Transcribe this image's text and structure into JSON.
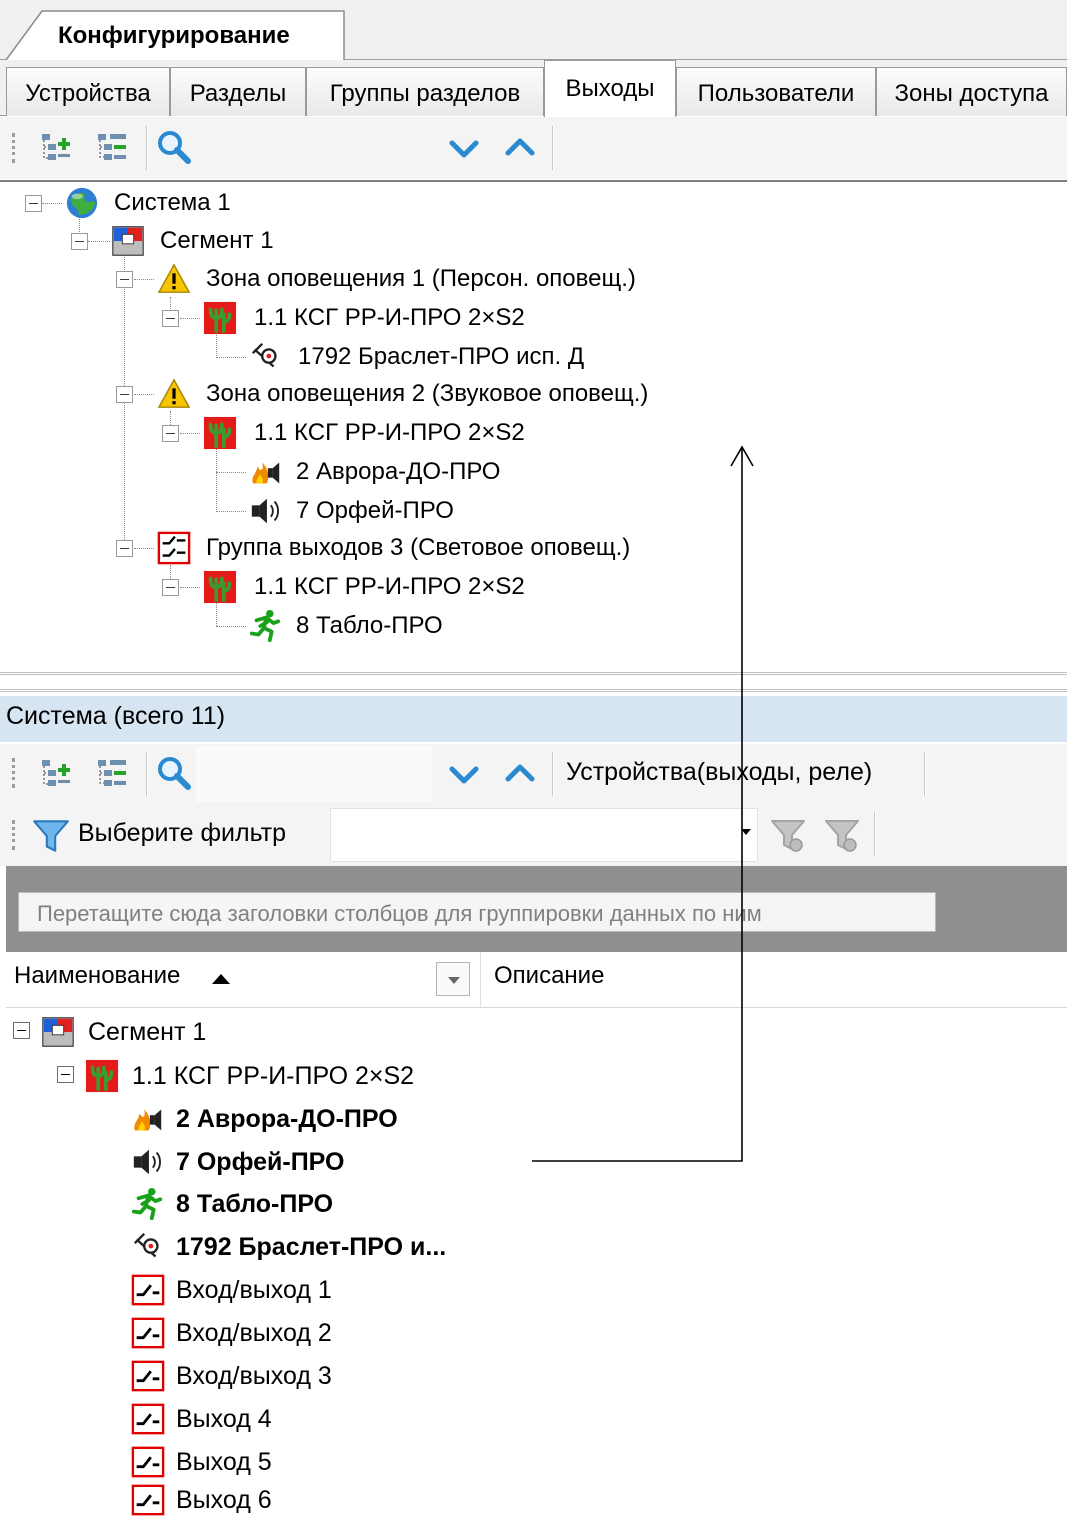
{
  "document_tab": {
    "label": "Конфигурирование"
  },
  "tabs": [
    {
      "label": "Устройства",
      "active": false
    },
    {
      "label": "Разделы",
      "active": false
    },
    {
      "label": "Группы разделов",
      "active": false
    },
    {
      "label": "Выходы",
      "active": true
    },
    {
      "label": "Пользователи",
      "active": false
    },
    {
      "label": "Зоны доступа",
      "active": false
    }
  ],
  "top_toolbar": {
    "icons": [
      "add-node-icon",
      "tree-list-icon",
      "search-icon",
      "chevron-down-icon",
      "chevron-up-icon"
    ]
  },
  "tree": {
    "system": {
      "label": "Система 1",
      "icon": "globe-icon"
    },
    "segment": {
      "label": "Сегмент 1",
      "icon": "segment-icon"
    },
    "zone1": {
      "label": "Зона оповещения 1 (Персон. оповещ.)",
      "icon": "warning-icon"
    },
    "zone1_device": {
      "label": "1.1 КСГ РР-И-ПРО 2×S2",
      "icon": "controller-icon"
    },
    "zone1_item1": {
      "label": "1792 Браслет-ПРО исп. Д",
      "icon": "bracelet-icon"
    },
    "zone2": {
      "label": "Зона оповещения 2 (Звуковое оповещ.)",
      "icon": "warning-icon"
    },
    "zone2_device": {
      "label": "1.1 КСГ РР-И-ПРО 2×S2",
      "icon": "controller-icon"
    },
    "zone2_item1": {
      "label": "2 Аврора-ДО-ПРО",
      "icon": "siren-icon"
    },
    "zone2_item2": {
      "label": "7 Орфей-ПРО",
      "icon": "speaker-icon"
    },
    "group3": {
      "label": "Группа выходов 3 (Световое оповещ.)",
      "icon": "output-group-icon"
    },
    "group3_device": {
      "label": "1.1 КСГ РР-И-ПРО 2×S2",
      "icon": "controller-icon"
    },
    "group3_item1": {
      "label": "8 Табло-ПРО",
      "icon": "exit-sign-icon"
    }
  },
  "lower_panel": {
    "header": "Система (всего 11)",
    "toolbar_title": "Устройства(выходы, реле)",
    "filter_label": "Выберите фильтр",
    "group_hint": "Перетащите сюда заголовки столбцов для группировки данных по ним",
    "columns": [
      "Наименование",
      "Описание"
    ],
    "rows": [
      {
        "label": "Сегмент 1",
        "icon": "segment-icon",
        "level": 0,
        "bold": false
      },
      {
        "label": "1.1 КСГ РР-И-ПРО 2×S2",
        "icon": "controller-icon",
        "level": 1,
        "bold": false
      },
      {
        "label": "2 Аврора-ДО-ПРО",
        "icon": "siren-icon",
        "level": 2,
        "bold": true
      },
      {
        "label": "7 Орфей-ПРО",
        "icon": "speaker-icon",
        "level": 2,
        "bold": true
      },
      {
        "label": "8 Табло-ПРО",
        "icon": "exit-sign-icon",
        "level": 2,
        "bold": true
      },
      {
        "label": "1792 Браслет-ПРО и...",
        "icon": "bracelet-icon",
        "level": 2,
        "bold": true
      },
      {
        "label": "Вход/выход 1",
        "icon": "relay-icon",
        "level": 2,
        "bold": false
      },
      {
        "label": "Вход/выход 2",
        "icon": "relay-icon",
        "level": 2,
        "bold": false
      },
      {
        "label": "Вход/выход 3",
        "icon": "relay-icon",
        "level": 2,
        "bold": false
      },
      {
        "label": "Выход 4",
        "icon": "relay-icon",
        "level": 2,
        "bold": false
      },
      {
        "label": "Выход 5",
        "icon": "relay-icon",
        "level": 2,
        "bold": false
      },
      {
        "label": "Выход 6",
        "icon": "relay-icon",
        "level": 2,
        "bold": false
      }
    ]
  },
  "colors": {
    "panel_header_bg": "#d7e4f2",
    "accent_blue": "#2a8ad0",
    "relay_red": "#e00000",
    "exit_green": "#1aa11a"
  }
}
